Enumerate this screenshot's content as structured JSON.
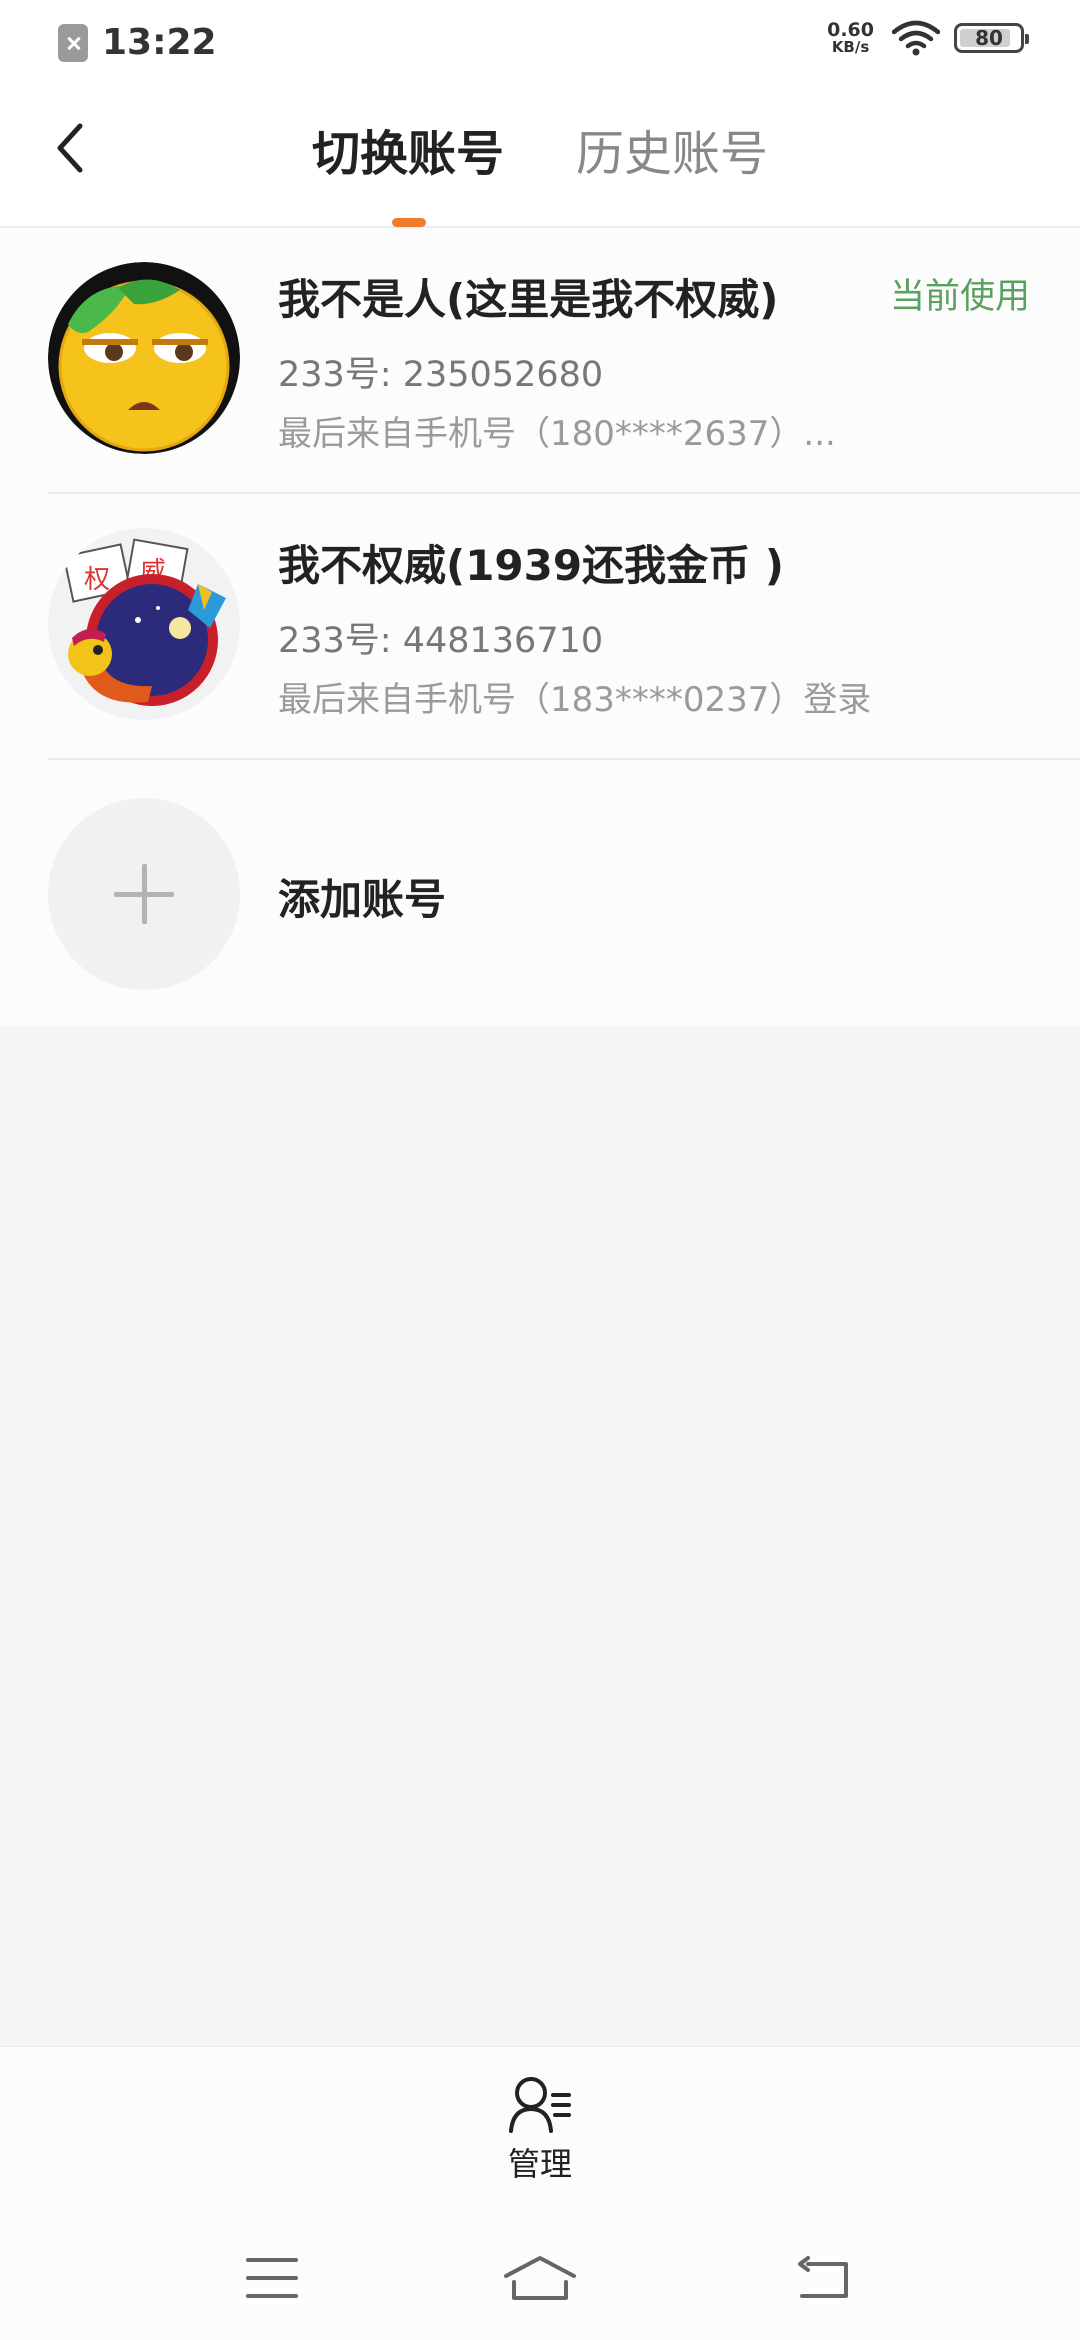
{
  "status_bar": {
    "time": "13:22",
    "net_speed_value": "0.60",
    "net_speed_unit": "KB/s",
    "battery": "80",
    "icons": [
      "notification-blocked-icon",
      "wifi-icon",
      "battery-icon"
    ]
  },
  "header": {
    "tabs": [
      {
        "label": "切换账号",
        "active": true
      },
      {
        "label": "历史账号",
        "active": false
      }
    ],
    "accent_color": "#f07c2b"
  },
  "accounts": [
    {
      "name": "我不是人(这里是我不权威)",
      "id_line": "233号: 235052680",
      "last_line": "最后来自手机号（180****2637）...",
      "badge": "当前使用",
      "badge_color": "#5aa05e"
    },
    {
      "name": "我不权威(1939还我金币 )",
      "id_line": "233号: 448136710",
      "last_line": "最后来自手机号（183****0237）登录"
    }
  ],
  "add_account": {
    "label": "添加账号"
  },
  "bottom": {
    "manage_label": "管理"
  },
  "nav": {
    "icons": [
      "menu-icon",
      "home-icon",
      "back-icon"
    ]
  }
}
